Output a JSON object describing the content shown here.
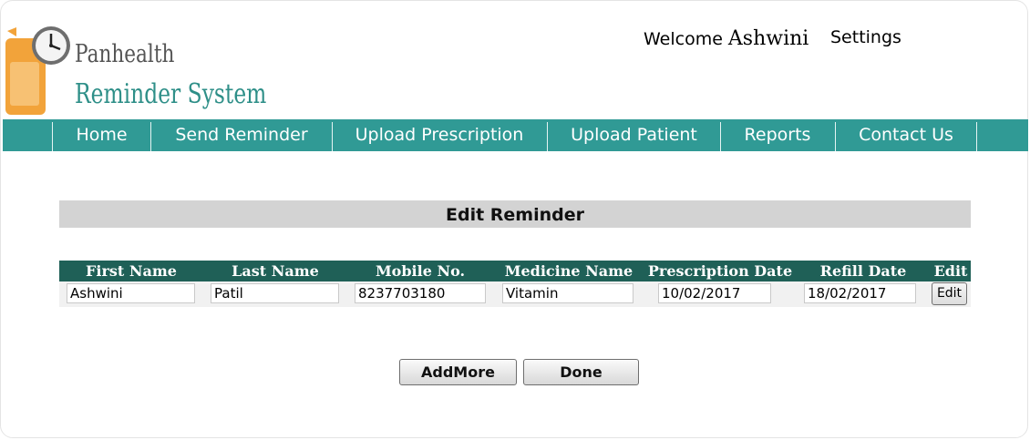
{
  "brand": {
    "line1": "Panhealth",
    "line2": "Reminder System",
    "colors": {
      "line1": "#555555",
      "line2": "#2e8f88",
      "logo_orange": "#f2a33a"
    }
  },
  "header": {
    "welcome_label": "Welcome",
    "username": "Ashwini",
    "settings_label": "Settings"
  },
  "nav": {
    "background": "#309a95",
    "items": [
      {
        "label": "Home"
      },
      {
        "label": "Send Reminder"
      },
      {
        "label": "Upload Prescription"
      },
      {
        "label": "Upload Patient"
      },
      {
        "label": "Reports"
      },
      {
        "label": "Contact Us"
      }
    ]
  },
  "page": {
    "title": "Edit Reminder"
  },
  "table": {
    "header_background": "#1f6057",
    "columns": [
      "First Name",
      "Last Name",
      "Mobile No.",
      "Medicine Name",
      "Prescription Date",
      "Refill Date",
      "Edit"
    ],
    "rows": [
      {
        "first_name": "Ashwini",
        "last_name": "Patil",
        "mobile": "8237703180",
        "medicine": "Vitamin",
        "prescription_date": "10/02/2017",
        "refill_date": "18/02/2017",
        "edit_label": "Edit"
      }
    ]
  },
  "actions": {
    "add_more_label": "AddMore",
    "done_label": "Done"
  }
}
